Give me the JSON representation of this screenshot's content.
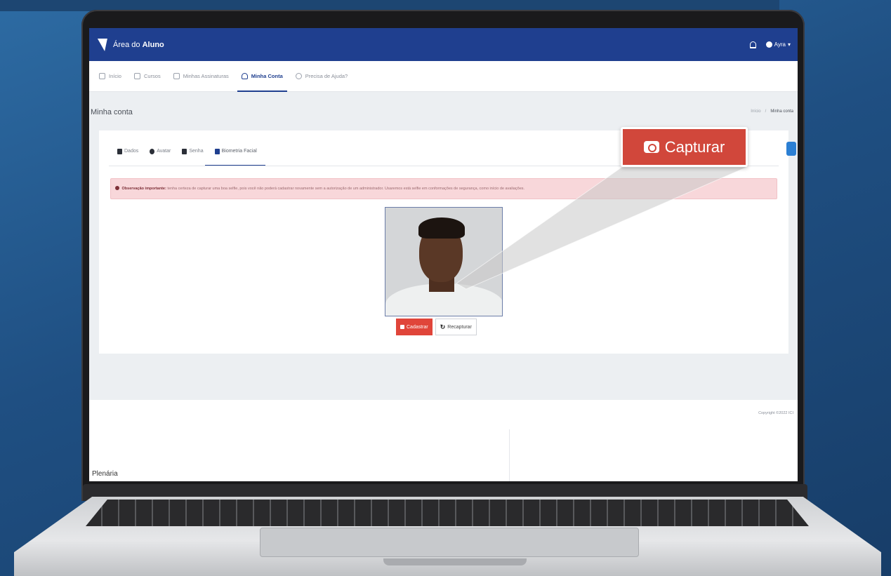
{
  "app": {
    "brand_prefix": "Área do ",
    "brand_bold": "Aluno",
    "user_name": "Ayra"
  },
  "nav": [
    {
      "label": "Início"
    },
    {
      "label": "Cursos"
    },
    {
      "label": "Minhas Assinaturas"
    },
    {
      "label": "Minha Conta",
      "active": true
    },
    {
      "label": "Precisa de Ajuda?"
    }
  ],
  "page": {
    "title": "Minha conta",
    "breadcrumb": [
      "Início",
      "Minha conta"
    ]
  },
  "tabs": [
    {
      "label": "Dados"
    },
    {
      "label": "Avatar"
    },
    {
      "label": "Senha"
    },
    {
      "label": "Biometria Facial",
      "active": true
    }
  ],
  "alert": {
    "label": "Observação importante:",
    "text": " tenha certeza de capturar uma boa selfie, pois você não poderá cadastrar novamente sem a autorização de um administrador. Usaremos está selfie em conformações de segurança, como início de avaliações."
  },
  "buttons": {
    "register": "Cadastrar",
    "recapture": "Recapturar"
  },
  "footer": {
    "copyright": "Copyright ©2022 ICI",
    "section": "Plenária"
  },
  "callout": {
    "label": "Capturar"
  },
  "colors": {
    "primary": "#1f3f8f",
    "danger": "#e0453a",
    "callout": "#d1473b",
    "alert_bg": "#f8d7da"
  }
}
